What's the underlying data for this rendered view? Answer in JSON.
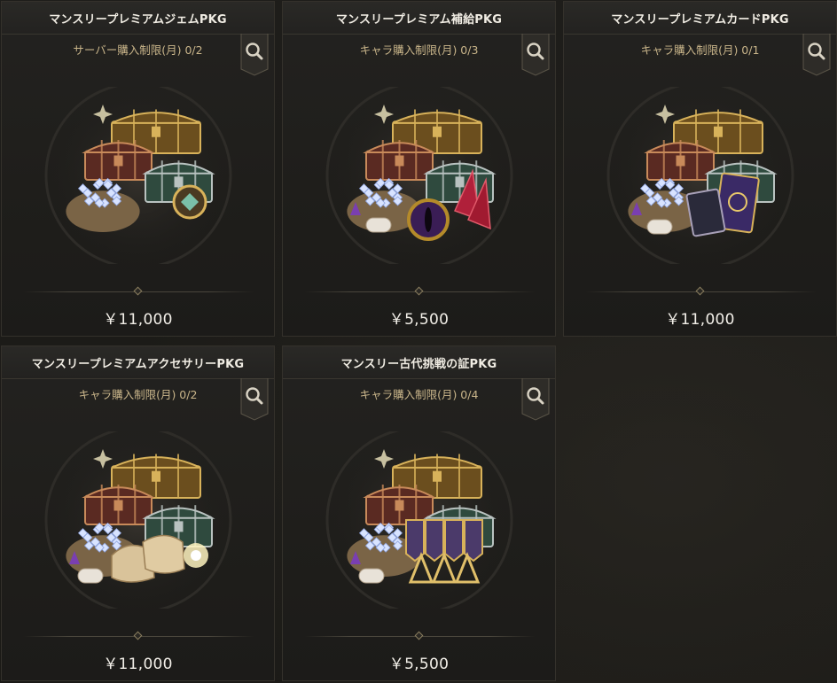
{
  "products": [
    {
      "title": "マンスリープレミアムジェムPKG",
      "limit": "サーバー購入制限(月) 0/2",
      "price": "￥11,000",
      "art": "gem"
    },
    {
      "title": "マンスリープレミアム補給PKG",
      "limit": "キャラ購入制限(月) 0/3",
      "price": "￥5,500",
      "art": "supply"
    },
    {
      "title": "マンスリープレミアムカードPKG",
      "limit": "キャラ購入制限(月) 0/1",
      "price": "￥11,000",
      "art": "card"
    },
    {
      "title": "マンスリープレミアムアクセサリーPKG",
      "limit": "キャラ購入制限(月) 0/2",
      "price": "￥11,000",
      "art": "accessory"
    },
    {
      "title": "マンスリー古代挑戦の証PKG",
      "limit": "キャラ購入制限(月) 0/4",
      "price": "￥5,500",
      "art": "ancient"
    }
  ],
  "icons": {
    "search": "magnifier-icon",
    "divider": "diamond-ornament-icon"
  },
  "colors": {
    "title": "#f0ece3",
    "limit": "#c9b58a",
    "price": "#f2efe8",
    "gold": "#d8b25a",
    "background": "#1b1a17"
  }
}
